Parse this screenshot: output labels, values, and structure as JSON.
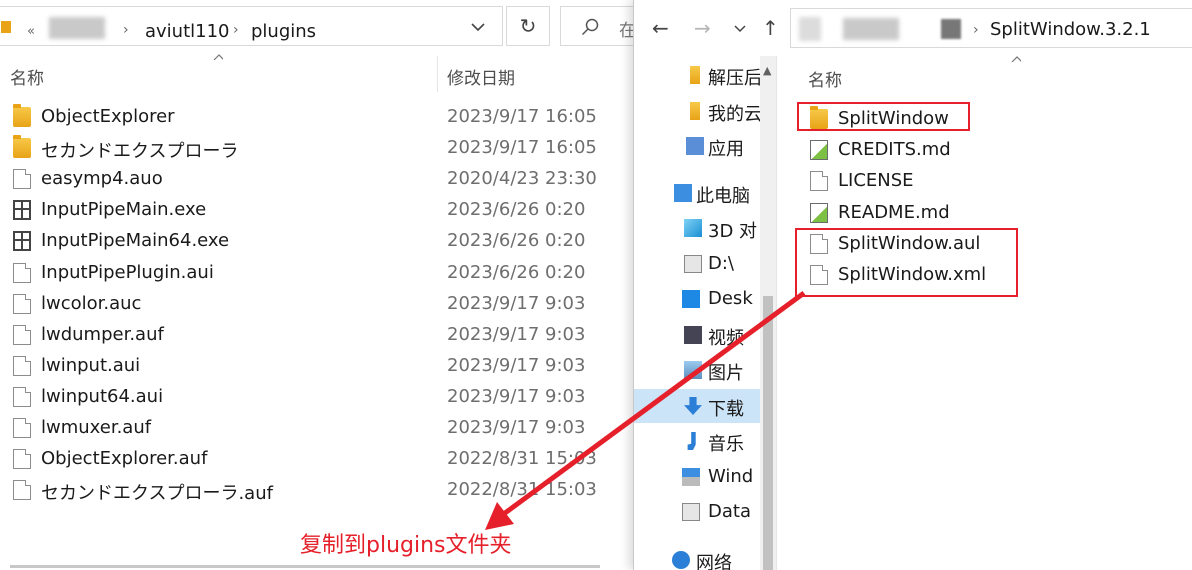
{
  "left_window": {
    "breadcrumb": {
      "overflow": "«",
      "segments": [
        "aviutl110",
        "plugins"
      ]
    },
    "search_partial": "在",
    "columns": {
      "name": "名称",
      "date_modified": "修改日期"
    },
    "files": [
      {
        "name": "ObjectExplorer",
        "date": "2023/9/17 16:05",
        "icon": "folder-icon"
      },
      {
        "name": "セカンドエクスプローラ",
        "date": "2023/9/17 16:05",
        "icon": "folder-icon"
      },
      {
        "name": "easymp4.auo",
        "date": "2020/4/23 23:30",
        "icon": "file-icon"
      },
      {
        "name": "InputPipeMain.exe",
        "date": "2023/6/26 0:20",
        "icon": "exe-icon"
      },
      {
        "name": "InputPipeMain64.exe",
        "date": "2023/6/26 0:20",
        "icon": "exe-icon"
      },
      {
        "name": "InputPipePlugin.aui",
        "date": "2023/6/26 0:20",
        "icon": "file-icon"
      },
      {
        "name": "lwcolor.auc",
        "date": "2023/9/17 9:03",
        "icon": "file-icon"
      },
      {
        "name": "lwdumper.auf",
        "date": "2023/9/17 9:03",
        "icon": "file-icon"
      },
      {
        "name": "lwinput.aui",
        "date": "2023/9/17 9:03",
        "icon": "file-icon"
      },
      {
        "name": "lwinput64.aui",
        "date": "2023/9/17 9:03",
        "icon": "file-icon"
      },
      {
        "name": "lwmuxer.auf",
        "date": "2023/9/17 9:03",
        "icon": "file-icon"
      },
      {
        "name": "ObjectExplorer.auf",
        "date": "2022/8/31 15:03",
        "icon": "file-icon"
      },
      {
        "name": "セカンドエクスプローラ.auf",
        "date": "2022/8/31 15:03",
        "icon": "file-icon"
      }
    ]
  },
  "right_window": {
    "breadcrumb": {
      "segments": [
        "SplitWindow.3.2.1"
      ]
    },
    "columns": {
      "name": "名称"
    },
    "nav_items": [
      {
        "label": "解压后",
        "icon": "folder-icon"
      },
      {
        "label": "我的云",
        "icon": "folder-icon"
      },
      {
        "label": "应用",
        "icon": "apps-icon"
      },
      {
        "label": "此电脑",
        "icon": "computer-icon"
      },
      {
        "label": "3D 对",
        "icon": "cube-icon"
      },
      {
        "label": "D:\\",
        "icon": "drive-icon"
      },
      {
        "label": "Desk",
        "icon": "desktop-icon"
      },
      {
        "label": "视频",
        "icon": "video-icon"
      },
      {
        "label": "图片",
        "icon": "picture-icon"
      },
      {
        "label": "下载",
        "icon": "download-icon"
      },
      {
        "label": "音乐",
        "icon": "music-icon"
      },
      {
        "label": "Wind",
        "icon": "windows-drive-icon"
      },
      {
        "label": "Data",
        "icon": "drive-icon"
      },
      {
        "label": "网络",
        "icon": "network-icon"
      }
    ],
    "selected_nav": "下载",
    "files": [
      {
        "name": "SplitWindow",
        "icon": "folder-icon"
      },
      {
        "name": "CREDITS.md",
        "icon": "md-icon"
      },
      {
        "name": "LICENSE",
        "icon": "file-icon"
      },
      {
        "name": "README.md",
        "icon": "md-icon"
      },
      {
        "name": "SplitWindow.aul",
        "icon": "file-icon"
      },
      {
        "name": "SplitWindow.xml",
        "icon": "file-icon"
      }
    ]
  },
  "annotation": {
    "text": "复制到plugins文件夹",
    "color": "#e5202a"
  }
}
